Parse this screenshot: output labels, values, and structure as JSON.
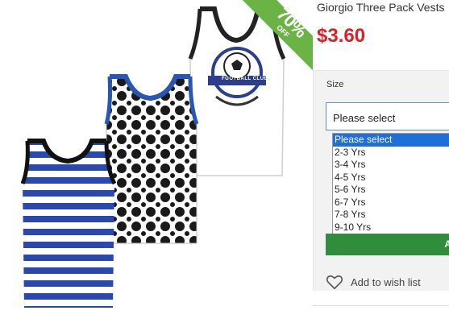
{
  "product": {
    "title": "Giorgio Three Pack Vests",
    "price": "$3.60"
  },
  "sale_badge": {
    "line1": "UP TO",
    "line2": "70%",
    "line3": "OFF",
    "color": "#6ab344"
  },
  "vest_logo": {
    "text": "FOOTBALL CLUB"
  },
  "size_selector": {
    "label": "Size",
    "value": "Please select",
    "options": [
      "Please select",
      "2-3 Yrs",
      "3-4 Yrs",
      "4-5 Yrs",
      "5-6 Yrs",
      "6-7 Yrs",
      "7-8 Yrs",
      "9-10 Yrs"
    ]
  },
  "add_button": {
    "label": "A"
  },
  "wishlist": {
    "label": "Add to wish list",
    "icon": "heart-icon"
  },
  "colors": {
    "price": "#e01e26",
    "add_button": "#2f8d3b",
    "selected_option": "#1e6fd9"
  }
}
